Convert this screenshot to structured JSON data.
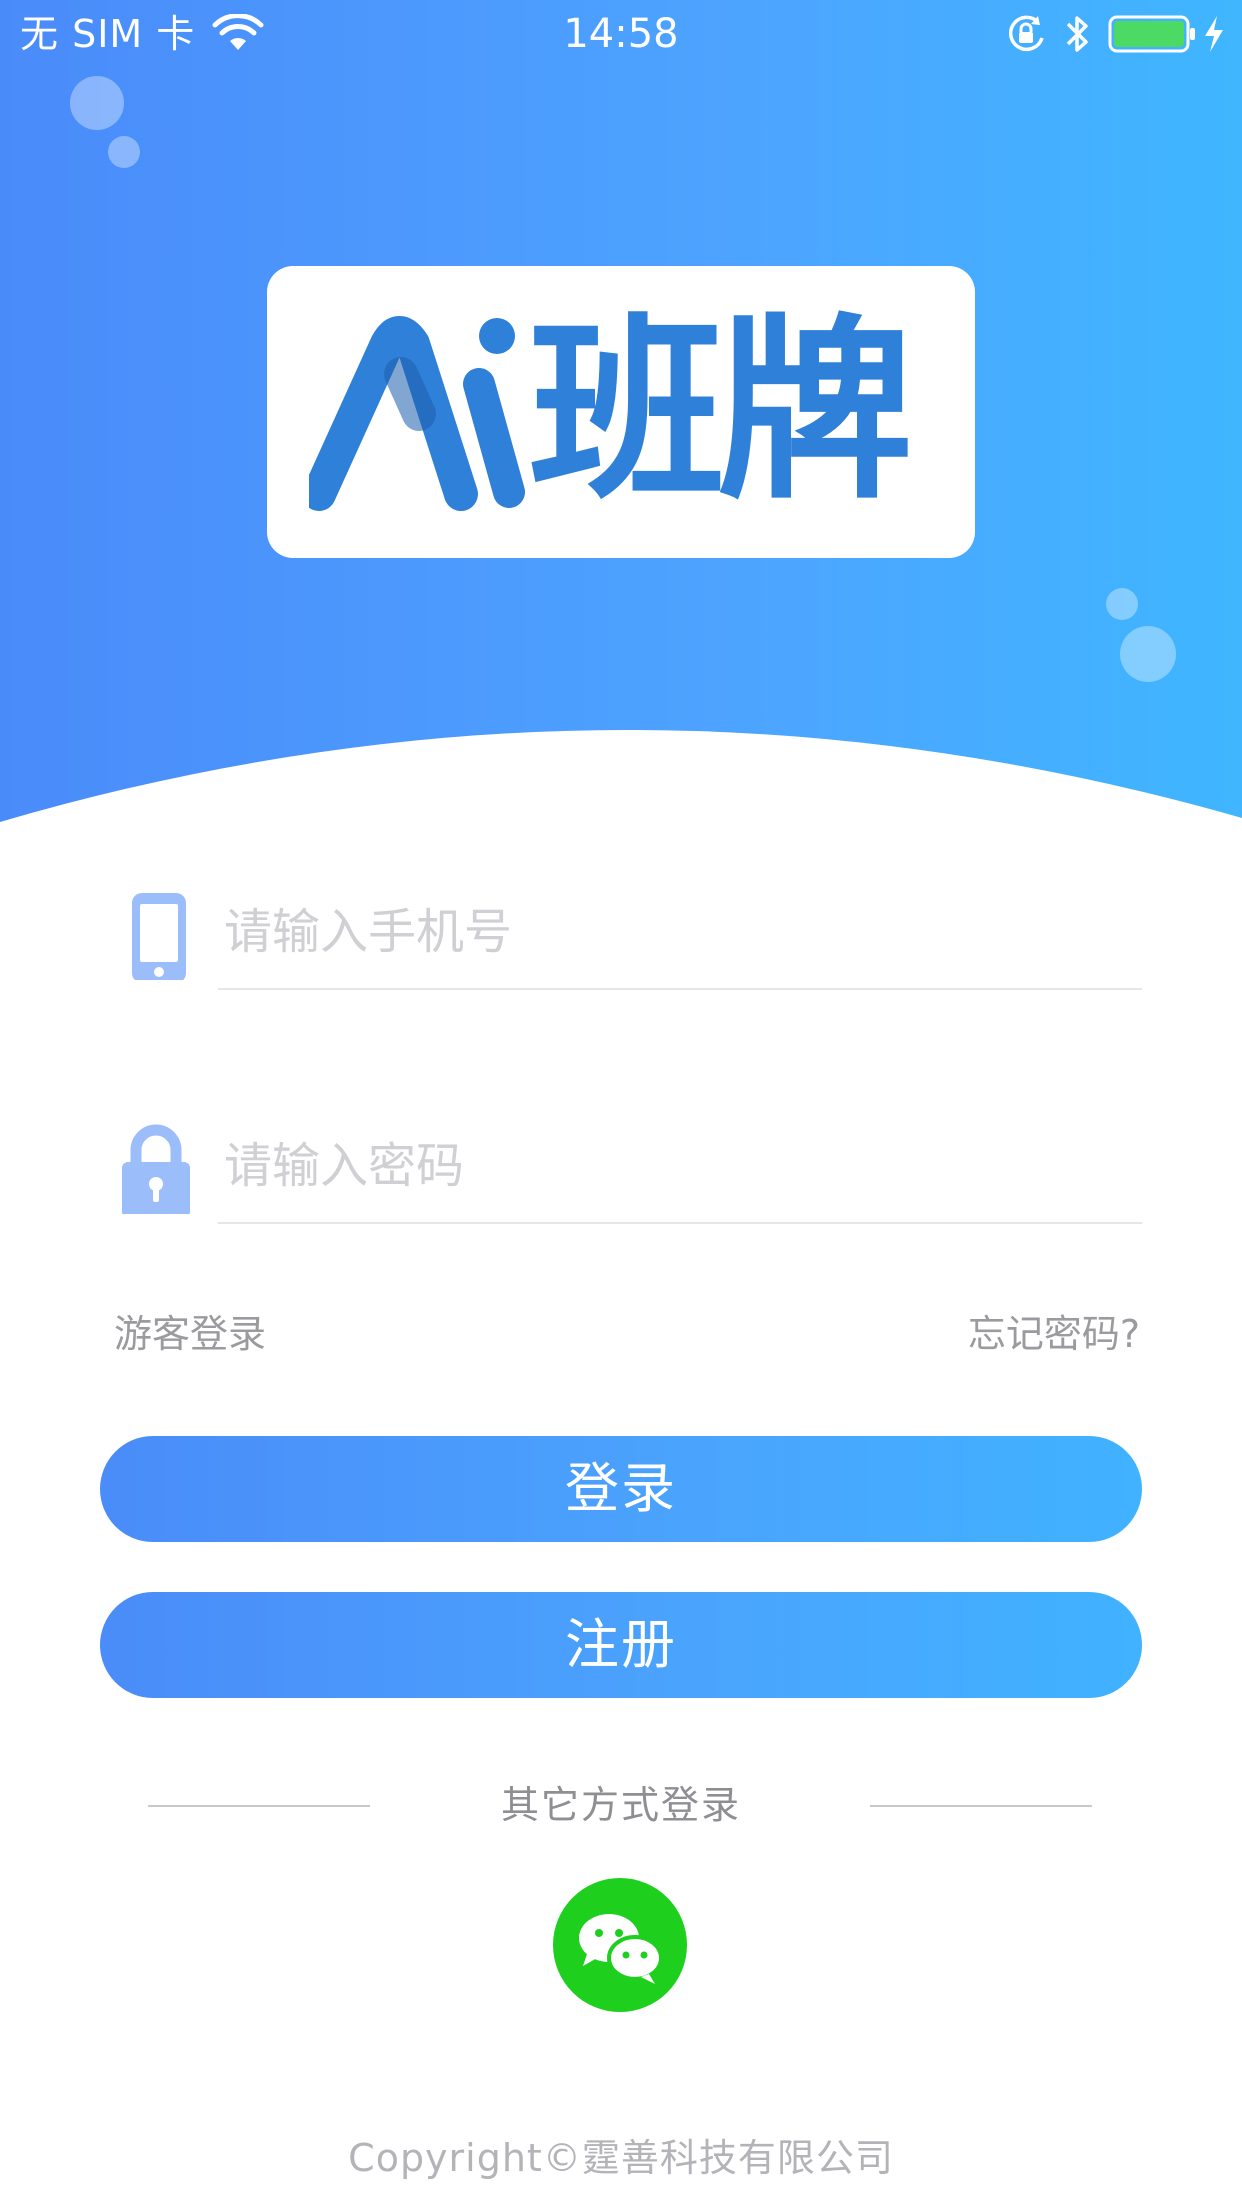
{
  "status_bar": {
    "carrier": "无 SIM 卡",
    "time": "14:58",
    "battery_color": "#4cd964"
  },
  "logo": {
    "text": "班牌",
    "color": "#2f80d9"
  },
  "login_form": {
    "phone_placeholder": "请输入手机号",
    "phone_icon": "phone-icon",
    "password_placeholder": "请输入密码",
    "password_icon": "lock-icon",
    "guest_login": "游客登录",
    "forgot_password": "忘记密码?",
    "login_button": "登录",
    "register_button": "注册"
  },
  "other_login": {
    "label": "其它方式登录",
    "wechat_icon": "wechat-icon",
    "wechat_color": "#1ecf1e"
  },
  "footer": {
    "copyright": "Copyright©霆善科技有限公司"
  },
  "theme": {
    "accent_start": "#4a8bfa",
    "accent_end": "#3fb6ff"
  }
}
